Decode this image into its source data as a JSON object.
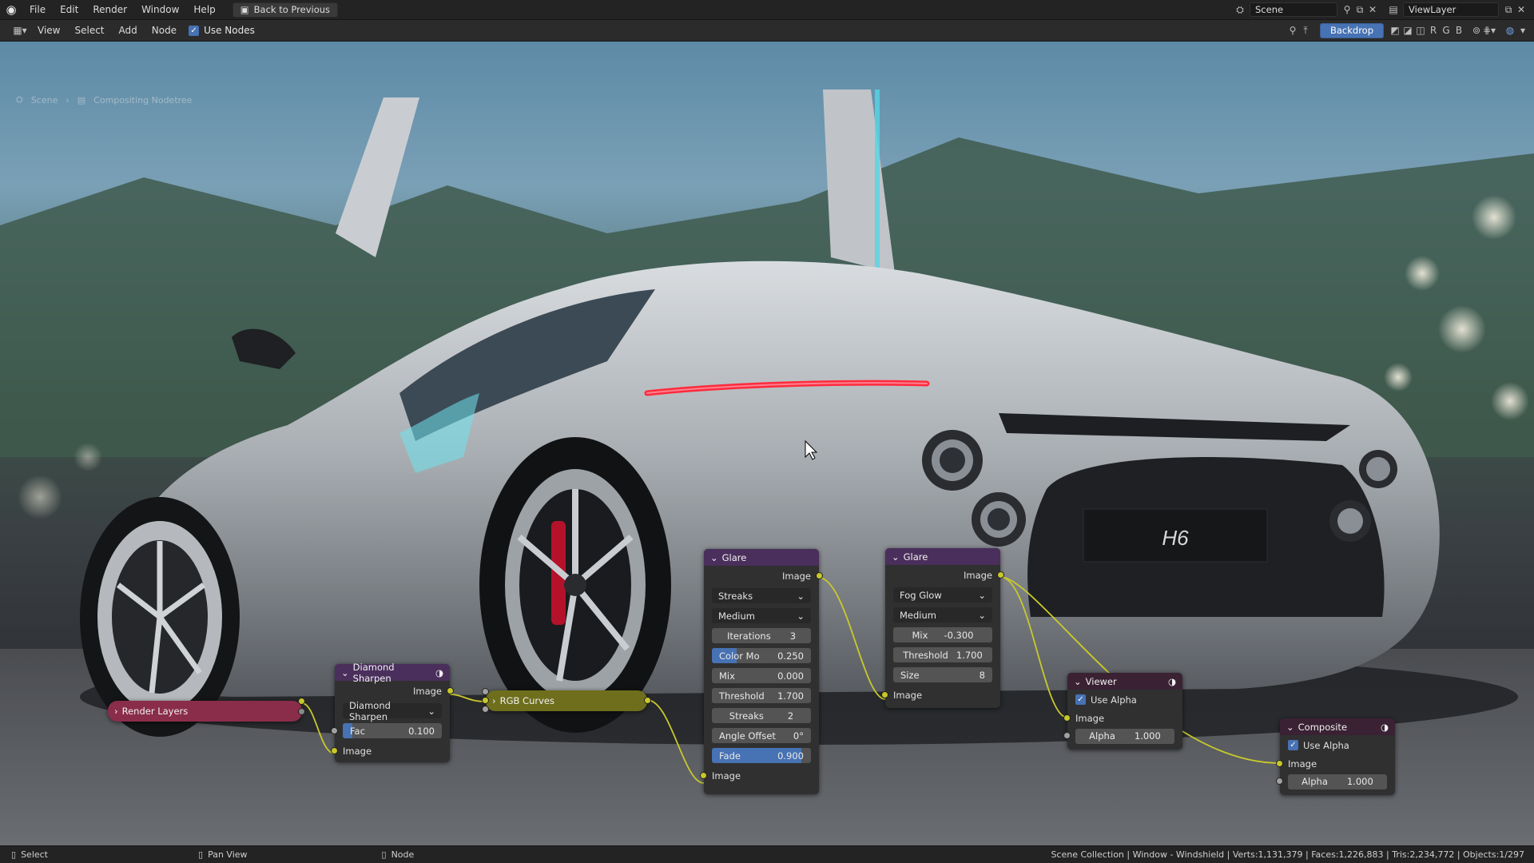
{
  "topbar": {
    "menus": [
      "File",
      "Edit",
      "Render",
      "Window",
      "Help"
    ],
    "back_button": "Back to Previous",
    "scene_field": "Scene",
    "viewlayer_field": "ViewLayer"
  },
  "header": {
    "menus": [
      "View",
      "Select",
      "Add",
      "Node"
    ],
    "use_nodes_label": "Use Nodes",
    "backdrop_button": "Backdrop",
    "channel_buttons": [
      "R",
      "G",
      "B"
    ]
  },
  "breadcrumb": [
    "Scene",
    "Compositing Nodetree"
  ],
  "car": {
    "badge": "H6"
  },
  "nodes": {
    "render_layers": {
      "title": "Render Layers"
    },
    "diamond_sharpen": {
      "title": "Diamond Sharpen",
      "output": "Image",
      "dropdown": "Diamond Sharpen",
      "fac_label": "Fac",
      "fac_value": "0.100",
      "fac_level": 0.1,
      "input": "Image"
    },
    "rgb_curves": {
      "title": "RGB Curves"
    },
    "glare1": {
      "title": "Glare",
      "output": "Image",
      "type": "Streaks",
      "quality": "Medium",
      "fields": [
        {
          "label": "Iterations",
          "value": "3",
          "level": 0
        },
        {
          "label": "Color Mo",
          "value": "0.250",
          "level": 0.25
        },
        {
          "label": "Mix",
          "value": "0.000",
          "level": 0
        },
        {
          "label": "Threshold",
          "value": "1.700",
          "level": 0
        },
        {
          "label": "Streaks",
          "value": "2",
          "level": 0
        },
        {
          "label": "Angle Offset",
          "value": "0°",
          "level": 0
        },
        {
          "label": "Fade",
          "value": "0.900",
          "level": 0.9
        }
      ],
      "input": "Image"
    },
    "glare2": {
      "title": "Glare",
      "output": "Image",
      "type": "Fog Glow",
      "quality": "Medium",
      "fields": [
        {
          "label": "Mix",
          "value": "-0.300"
        },
        {
          "label": "Threshold",
          "value": "1.700"
        },
        {
          "label": "Size",
          "value": "8"
        }
      ],
      "input": "Image"
    },
    "viewer": {
      "title": "Viewer",
      "use_alpha": "Use Alpha",
      "input": "Image",
      "alpha_label": "Alpha",
      "alpha_value": "1.000"
    },
    "composite": {
      "title": "Composite",
      "use_alpha": "Use Alpha",
      "input": "Image",
      "alpha_label": "Alpha",
      "alpha_value": "1.000"
    }
  },
  "statusbar": {
    "select": "Select",
    "pan": "Pan View",
    "node": "Node",
    "info": "Scene Collection | Window - Windshield | Verts:1,131,379 | Faces:1,226,883 | Tris:2,234,772 | Objects:1/297"
  },
  "colors": {
    "accent": "#4772b3",
    "socket_image": "#c7c729",
    "render_layers_header": "#8a2d4a",
    "filter_header": "#4a2f5c",
    "rgb_curves_header": "#6e6e1d",
    "output_header": "#3a2234"
  }
}
